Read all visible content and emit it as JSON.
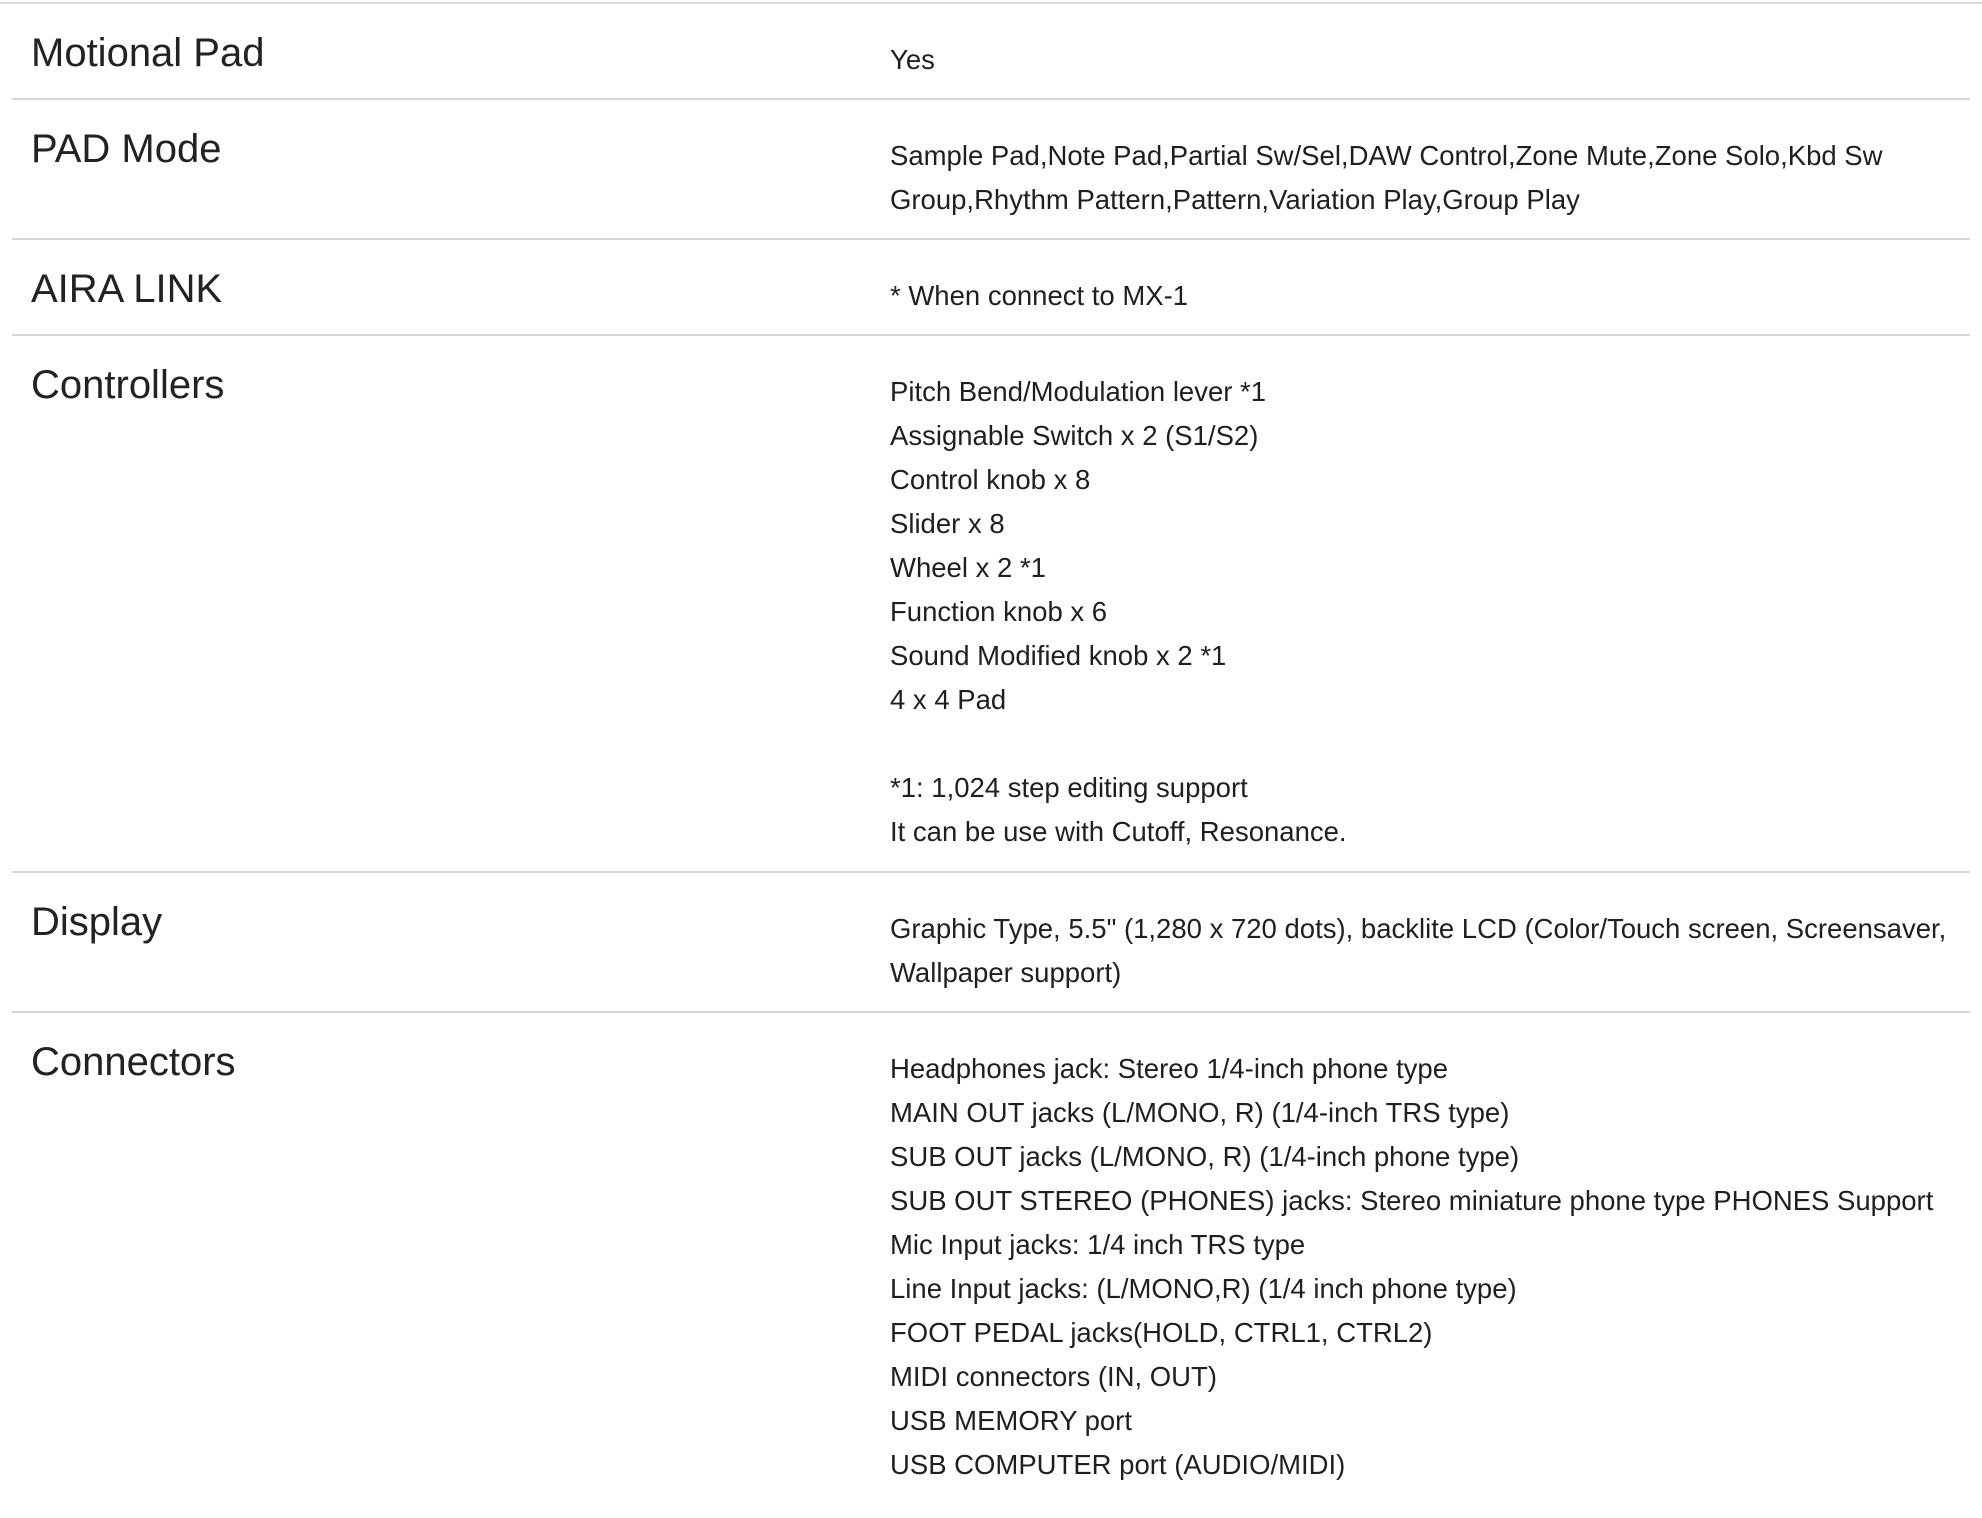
{
  "specs": [
    {
      "label": "Motional Pad",
      "lines": [
        "Yes"
      ]
    },
    {
      "label": "PAD Mode",
      "lines": [
        "Sample Pad,Note Pad,Partial Sw/Sel,DAW Control,Zone Mute,Zone Solo,Kbd Sw Group,Rhythm Pattern,Pattern,Variation Play,Group Play"
      ]
    },
    {
      "label": "AIRA LINK",
      "lines": [
        "* When connect to MX-1"
      ]
    },
    {
      "label": "Controllers",
      "lines": [
        "Pitch Bend/Modulation lever *1",
        "Assignable Switch x 2 (S1/S2)",
        "Control knob x 8",
        "Slider x 8",
        "Wheel x 2 *1",
        "Function knob x 6",
        "Sound Modified knob x 2 *1",
        "4 x 4 Pad",
        "",
        "*1: 1,024 step editing support",
        "It can be use with Cutoff, Resonance."
      ]
    },
    {
      "label": "Display",
      "lines": [
        "Graphic Type, 5.5\" (1,280 x 720 dots), backlite LCD (Color/Touch screen, Screensaver, Wallpaper support)"
      ]
    },
    {
      "label": "Connectors",
      "lines": [
        "Headphones jack: Stereo 1/4-inch phone type",
        "MAIN OUT jacks (L/MONO, R) (1/4-inch TRS type)",
        "SUB OUT jacks (L/MONO, R) (1/4-inch phone type)",
        "SUB OUT STEREO (PHONES) jacks: Stereo miniature phone type PHONES Support",
        "Mic Input jacks: 1/4 inch TRS type",
        "Line Input jacks: (L/MONO,R) (1/4 inch phone type)",
        "FOOT PEDAL jacks(HOLD, CTRL1, CTRL2)",
        "MIDI connectors (IN, OUT)",
        "USB MEMORY port",
        "USB COMPUTER port (AUDIO/MIDI)"
      ]
    }
  ]
}
